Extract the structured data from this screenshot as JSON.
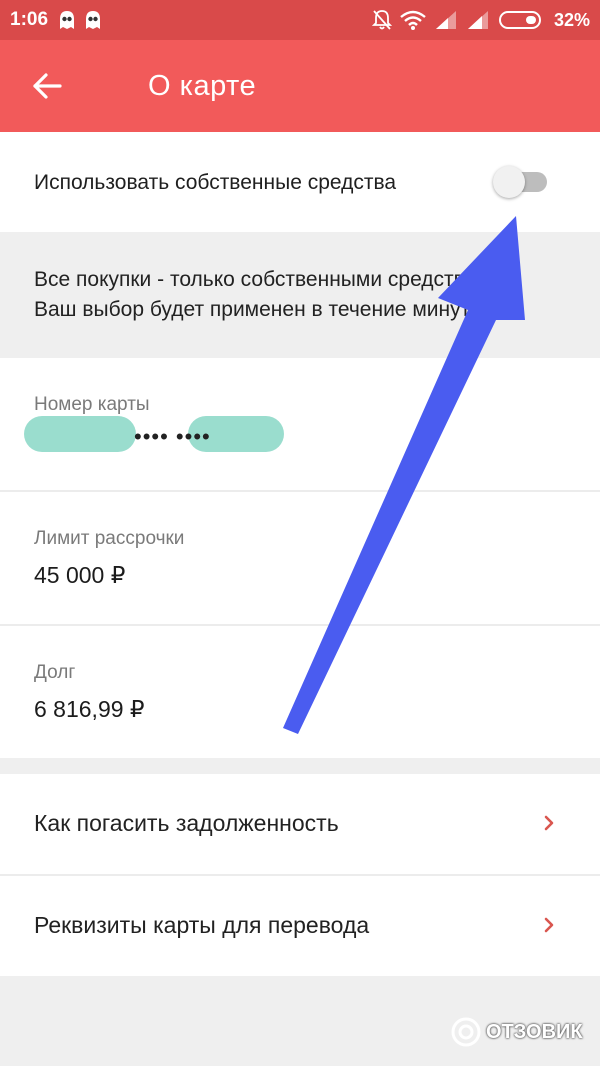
{
  "status_bar": {
    "time": "1:06",
    "battery": "32%"
  },
  "app_bar": {
    "title": "О карте",
    "back_icon": "arrow-left-icon"
  },
  "own_funds": {
    "label": "Использовать собственные средства",
    "toggle_state": "off"
  },
  "info": {
    "line1": "Все покупки - только собственными средствами.",
    "line2": "Ваш выбор будет применен в течение минуты"
  },
  "card_number": {
    "label": "Номер карты",
    "value": "•••• ••••"
  },
  "installment_limit": {
    "label": "Лимит рассрочки",
    "value": "45 000 ₽"
  },
  "debt": {
    "label": "Долг",
    "value": "6 816,99 ₽"
  },
  "links": [
    {
      "label": "Как погасить задолженность"
    },
    {
      "label": "Реквизиты карты для перевода"
    }
  ],
  "watermark": "ОТЗОВИК",
  "colors": {
    "status_bar": "#d94a4a",
    "app_bar": "#f25a5a",
    "chevron": "#d9564f",
    "annotation_arrow": "#4a5cf0"
  }
}
